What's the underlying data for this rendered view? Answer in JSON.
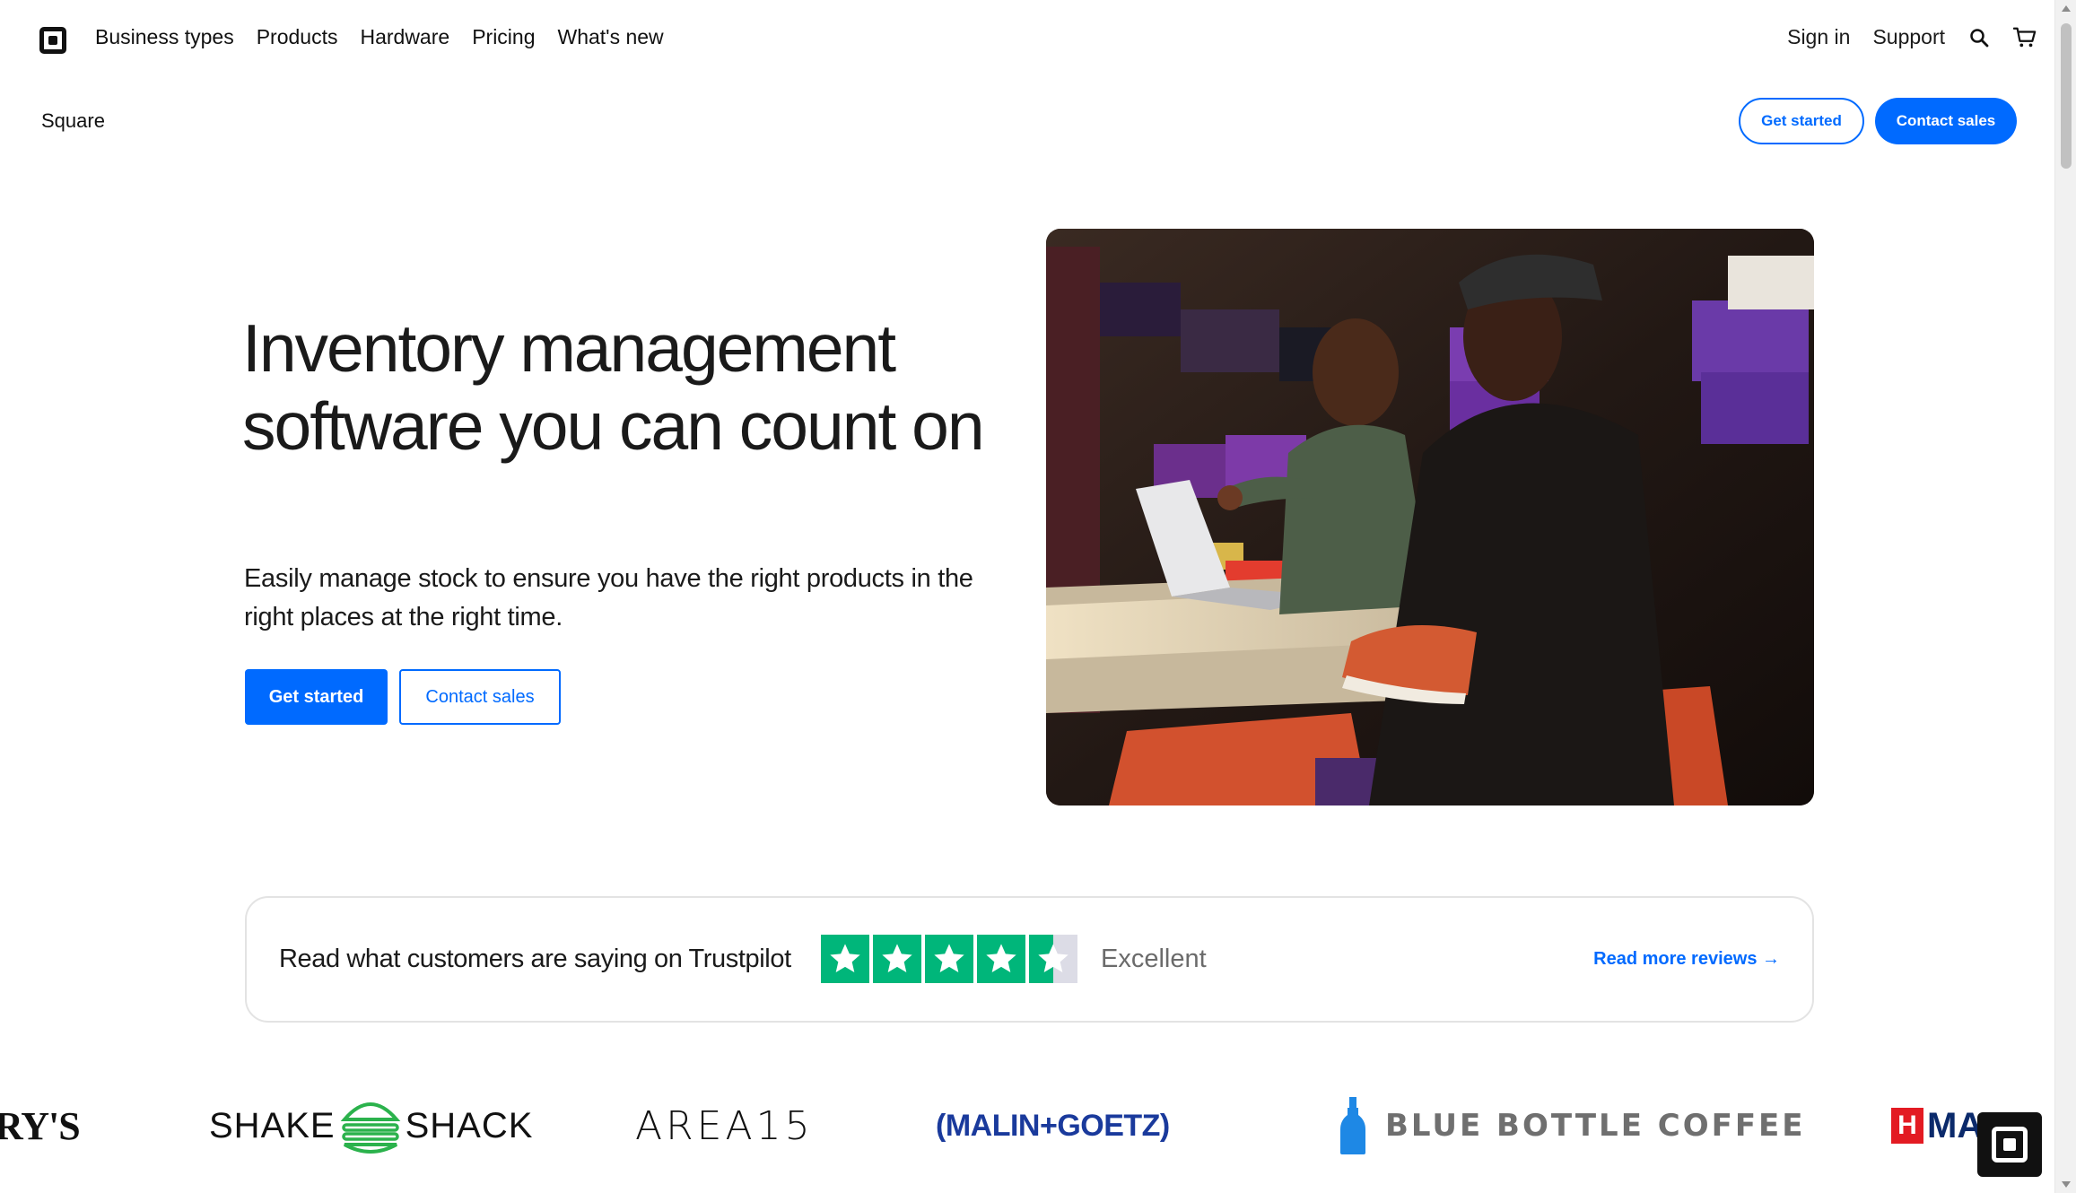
{
  "nav": {
    "links": [
      "Business types",
      "Products",
      "Hardware",
      "Pricing",
      "What's new"
    ],
    "sign_in": "Sign in",
    "support": "Support"
  },
  "subnav": {
    "title": "Square",
    "get_started": "Get started",
    "contact_sales": "Contact sales"
  },
  "hero": {
    "title": "Inventory management software you can count on",
    "subtitle": "Easily manage stock to ensure you have the right products in the right places at the right time.",
    "primary_cta": "Get started",
    "secondary_cta": "Contact sales"
  },
  "trustpilot": {
    "text": "Read what customers are saying on Trustpilot",
    "rating_word": "Excellent",
    "star_count": 4.5,
    "link": "Read more reviews →",
    "color": "#00b67a"
  },
  "brands": {
    "partial_left": "RY'S",
    "shake_left": "SHAKE",
    "shake_right": "SHACK",
    "area15": "AREA15",
    "malin": "(MALIN+GOETZ)",
    "bluebottle": "BLUE BOTTLE COFFEE",
    "partial_right": "MA"
  },
  "colors": {
    "accent": "#006aff"
  }
}
